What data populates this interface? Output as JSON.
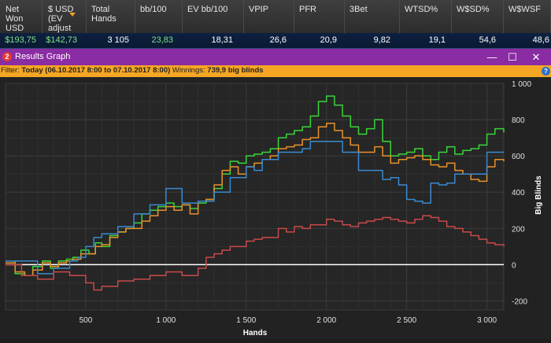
{
  "stats_header": {
    "columns": [
      {
        "label": "Net\nWon\nUSD",
        "value": "$193,75",
        "value_color": "#7fe07f"
      },
      {
        "label": "$ USD\n(EV\nadjust",
        "value": "$142,73",
        "value_color": "#7fe07f"
      },
      {
        "label": "Total\nHands",
        "value": "3 105",
        "value_color": "#ffffff"
      },
      {
        "label": "bb/100",
        "value": "23,83",
        "value_color": "#7fe07f"
      },
      {
        "label": "EV bb/100",
        "value": "18,31",
        "value_color": "#ffffff"
      },
      {
        "label": "VPIP",
        "value": "26,6",
        "value_color": "#ffffff"
      },
      {
        "label": "PFR",
        "value": "20,9",
        "value_color": "#ffffff"
      },
      {
        "label": "3Bet",
        "value": "9,82",
        "value_color": "#ffffff"
      },
      {
        "label": "WTSD%",
        "value": "19,1",
        "value_color": "#ffffff"
      },
      {
        "label": "W$SD%",
        "value": "54,6",
        "value_color": "#ffffff"
      },
      {
        "label": "W$WSF",
        "value": "48,6",
        "value_color": "#ffffff"
      }
    ]
  },
  "window": {
    "icon_text": "2",
    "title": "Results Graph",
    "minimize_glyph": "—",
    "maximize_glyph": "☐",
    "close_glyph": "✕"
  },
  "filter": {
    "label": "Filter:",
    "range": "Today (06.10.2017 8:00 to 07.10.2017 8:00)",
    "winnings_label": "Winnings:",
    "winnings_value": "739,9 big blinds",
    "help_glyph": "?"
  },
  "colors": {
    "green": "#3ad63a",
    "orange": "#e8922a",
    "blue": "#3a8ad0",
    "red": "#c84a4a",
    "zero_line": "#ffffff",
    "title_bar": "#8a2ca3",
    "filter_bar": "#f5a623"
  },
  "chart_data": {
    "type": "line",
    "xlabel": "Hands",
    "ylabel": "Big Blinds",
    "xlim": [
      0,
      3105
    ],
    "ylim": [
      -250,
      1000
    ],
    "x_ticks": [
      500,
      1000,
      1500,
      2000,
      2500,
      3000
    ],
    "x_tick_labels": [
      "500",
      "1 000",
      "1 500",
      "2 000",
      "2 500",
      "3 000"
    ],
    "y_ticks": [
      1000,
      800,
      600,
      400,
      200,
      0,
      -200
    ],
    "y_tick_labels": [
      "1 000",
      "800",
      "600",
      "400",
      "200",
      "0",
      "-200"
    ],
    "grid": true,
    "series": [
      {
        "color": "#3ad63a",
        "step": true,
        "x": [
          0,
          60,
          120,
          170,
          230,
          280,
          330,
          380,
          420,
          470,
          520,
          560,
          600,
          650,
          700,
          750,
          800,
          850,
          900,
          950,
          1000,
          1050,
          1100,
          1150,
          1200,
          1250,
          1300,
          1350,
          1400,
          1450,
          1500,
          1550,
          1600,
          1650,
          1700,
          1750,
          1800,
          1850,
          1900,
          1950,
          2000,
          2050,
          2100,
          2150,
          2200,
          2250,
          2300,
          2350,
          2400,
          2450,
          2500,
          2550,
          2600,
          2650,
          2700,
          2750,
          2800,
          2850,
          2900,
          2950,
          3000,
          3050,
          3105
        ],
        "y": [
          20,
          -50,
          -60,
          -10,
          20,
          -20,
          20,
          30,
          40,
          80,
          60,
          120,
          100,
          160,
          180,
          200,
          230,
          280,
          300,
          320,
          340,
          320,
          330,
          310,
          340,
          360,
          420,
          500,
          570,
          560,
          600,
          610,
          620,
          640,
          700,
          720,
          740,
          760,
          820,
          900,
          930,
          880,
          820,
          760,
          720,
          750,
          800,
          680,
          600,
          610,
          620,
          640,
          600,
          580,
          620,
          650,
          610,
          630,
          640,
          660,
          720,
          750,
          730
        ]
      },
      {
        "color": "#e8922a",
        "step": true,
        "x": [
          0,
          60,
          120,
          170,
          230,
          280,
          330,
          380,
          420,
          470,
          520,
          560,
          600,
          650,
          700,
          750,
          800,
          850,
          900,
          950,
          1000,
          1050,
          1100,
          1150,
          1200,
          1250,
          1300,
          1350,
          1400,
          1450,
          1500,
          1550,
          1600,
          1650,
          1700,
          1750,
          1800,
          1850,
          1900,
          1950,
          2000,
          2050,
          2100,
          2150,
          2200,
          2250,
          2300,
          2350,
          2400,
          2450,
          2500,
          2550,
          2600,
          2650,
          2700,
          2750,
          2800,
          2850,
          2900,
          2950,
          3000,
          3050,
          3105
        ],
        "y": [
          10,
          -40,
          -60,
          -30,
          10,
          -10,
          10,
          20,
          30,
          60,
          60,
          100,
          110,
          150,
          180,
          200,
          200,
          240,
          270,
          300,
          320,
          300,
          330,
          280,
          350,
          360,
          440,
          520,
          540,
          500,
          540,
          560,
          580,
          600,
          640,
          650,
          660,
          690,
          700,
          760,
          780,
          740,
          700,
          660,
          620,
          620,
          650,
          600,
          560,
          580,
          590,
          600,
          580,
          550,
          540,
          560,
          520,
          500,
          470,
          460,
          540,
          580,
          570
        ]
      },
      {
        "color": "#3a8ad0",
        "step": true,
        "x": [
          0,
          100,
          200,
          300,
          400,
          450,
          500,
          550,
          600,
          700,
          800,
          900,
          1000,
          1100,
          1200,
          1300,
          1400,
          1500,
          1550,
          1600,
          1700,
          1800,
          1850,
          1900,
          2000,
          2100,
          2200,
          2300,
          2350,
          2400,
          2450,
          2500,
          2550,
          2600,
          2650,
          2700,
          2750,
          2800,
          2900,
          3000,
          3105
        ],
        "y": [
          20,
          20,
          -50,
          -20,
          20,
          40,
          100,
          150,
          170,
          210,
          280,
          330,
          420,
          340,
          350,
          400,
          480,
          540,
          520,
          580,
          620,
          620,
          640,
          680,
          680,
          620,
          520,
          520,
          470,
          480,
          440,
          360,
          350,
          340,
          450,
          440,
          450,
          500,
          500,
          620,
          620
        ]
      },
      {
        "color": "#c84a4a",
        "step": true,
        "x": [
          0,
          100,
          200,
          300,
          400,
          500,
          550,
          600,
          700,
          800,
          900,
          1000,
          1100,
          1200,
          1250,
          1300,
          1350,
          1400,
          1500,
          1550,
          1600,
          1700,
          1750,
          1800,
          1850,
          1900,
          2000,
          2050,
          2100,
          2150,
          2200,
          2250,
          2300,
          2350,
          2400,
          2450,
          2500,
          2550,
          2600,
          2650,
          2700,
          2750,
          2800,
          2850,
          2900,
          2950,
          3000,
          3050,
          3105
        ],
        "y": [
          0,
          -60,
          -80,
          -40,
          -60,
          -100,
          -140,
          -120,
          -90,
          -80,
          -60,
          -40,
          -60,
          -20,
          40,
          60,
          80,
          100,
          130,
          140,
          150,
          200,
          180,
          210,
          200,
          220,
          250,
          240,
          220,
          210,
          230,
          240,
          250,
          260,
          250,
          240,
          230,
          250,
          270,
          260,
          240,
          210,
          200,
          180,
          160,
          140,
          120,
          110,
          100
        ]
      }
    ]
  }
}
